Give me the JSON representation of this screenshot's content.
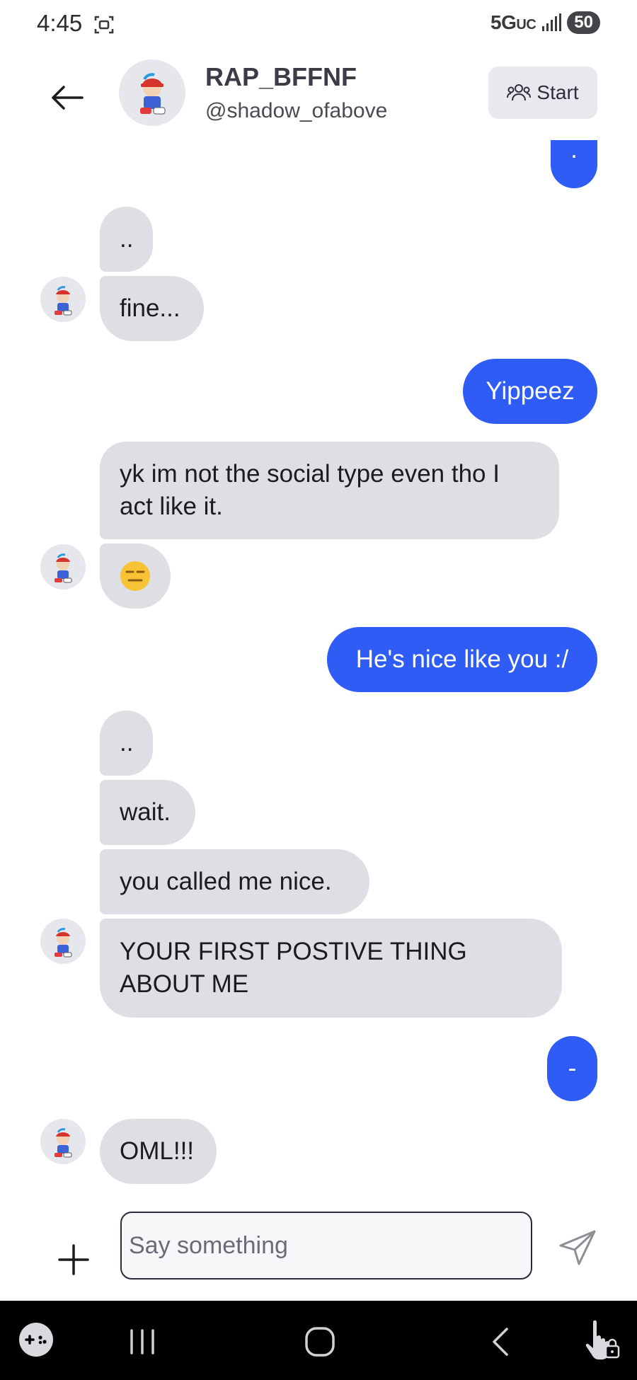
{
  "status": {
    "time": "4:45",
    "network": "5G",
    "network_sub": "UC",
    "battery": "50"
  },
  "header": {
    "name": "RAP_BFFNF",
    "handle": "@shadow_ofabove",
    "start_label": "Start"
  },
  "messages": [
    {
      "side": "out",
      "text": "."
    },
    {
      "side": "in",
      "text": ".."
    },
    {
      "side": "in",
      "text": "fine..."
    },
    {
      "side": "out",
      "text": "Yippeez"
    },
    {
      "side": "in",
      "text": "yk im not the social type even tho I act like it."
    },
    {
      "side": "in",
      "text": "",
      "emoji": "expressionless-face"
    },
    {
      "side": "out",
      "text": "He's nice like you :/"
    },
    {
      "side": "in",
      "text": ".."
    },
    {
      "side": "in",
      "text": "wait."
    },
    {
      "side": "in",
      "text": "you called me nice."
    },
    {
      "side": "in",
      "text": "YOUR FIRST POSTIVE THING ABOUT ME"
    },
    {
      "side": "out",
      "text": "-"
    },
    {
      "side": "in",
      "text": "OML!!!"
    }
  ],
  "composer": {
    "placeholder": "Say something"
  },
  "icons": {
    "back": "arrow-left-icon",
    "start": "users-icon",
    "plus": "plus-icon",
    "send": "send-icon",
    "nav": [
      "gamepad-icon",
      "recent-apps-icon",
      "home-icon",
      "back-icon",
      "touch-lock-icon"
    ]
  },
  "colors": {
    "outgoing": "#2e5cf5",
    "incoming": "#dedfe4",
    "emoji": "#f7c236"
  }
}
